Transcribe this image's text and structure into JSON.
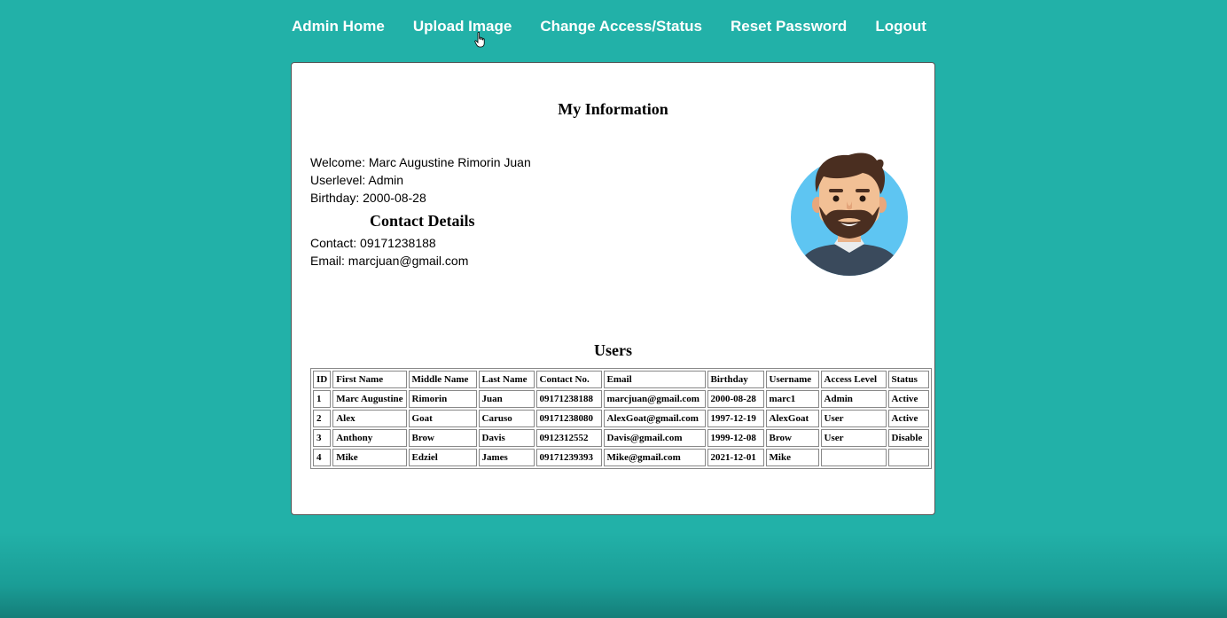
{
  "nav": {
    "items": [
      {
        "label": "Admin Home"
      },
      {
        "label": "Upload Image"
      },
      {
        "label": "Change Access/Status"
      },
      {
        "label": "Reset Password"
      },
      {
        "label": "Logout"
      }
    ]
  },
  "profile": {
    "title": "My Information",
    "welcome": "Welcome: Marc Augustine Rimorin Juan",
    "userlevel": "Userlevel: Admin",
    "birthday": "Birthday: 2000-08-28",
    "contact_heading": "Contact Details",
    "contact": "Contact: 09171238188",
    "email": "Email: marcjuan@gmail.com"
  },
  "users": {
    "title": "Users",
    "columns": [
      "ID",
      "First Name",
      "Middle Name",
      "Last Name",
      "Contact No.",
      "Email",
      "Birthday",
      "Username",
      "Access Level",
      "Status"
    ],
    "rows": [
      [
        "1",
        "Marc Augustine",
        "Rimorin",
        "Juan",
        "09171238188",
        "marcjuan@gmail.com",
        "2000-08-28",
        "marc1",
        "Admin",
        "Active"
      ],
      [
        "2",
        "Alex",
        "Goat",
        "Caruso",
        "09171238080",
        "AlexGoat@gmail.com",
        "1997-12-19",
        "AlexGoat",
        "User",
        "Active"
      ],
      [
        "3",
        "Anthony",
        "Brow",
        "Davis",
        "0912312552",
        "Davis@gmail.com",
        "1999-12-08",
        "Brow",
        "User",
        "Disable"
      ],
      [
        "4",
        "Mike",
        "Edziel",
        "James",
        "09171239393",
        "Mike@gmail.com",
        "2021-12-01",
        "Mike",
        "",
        ""
      ]
    ]
  },
  "colors": {
    "background": "#22b1a8",
    "card": "#ffffff",
    "avatar_circle": "#5ec5f2"
  },
  "icons": {
    "avatar": "avatar-icon",
    "cursor": "hand-cursor-icon"
  }
}
